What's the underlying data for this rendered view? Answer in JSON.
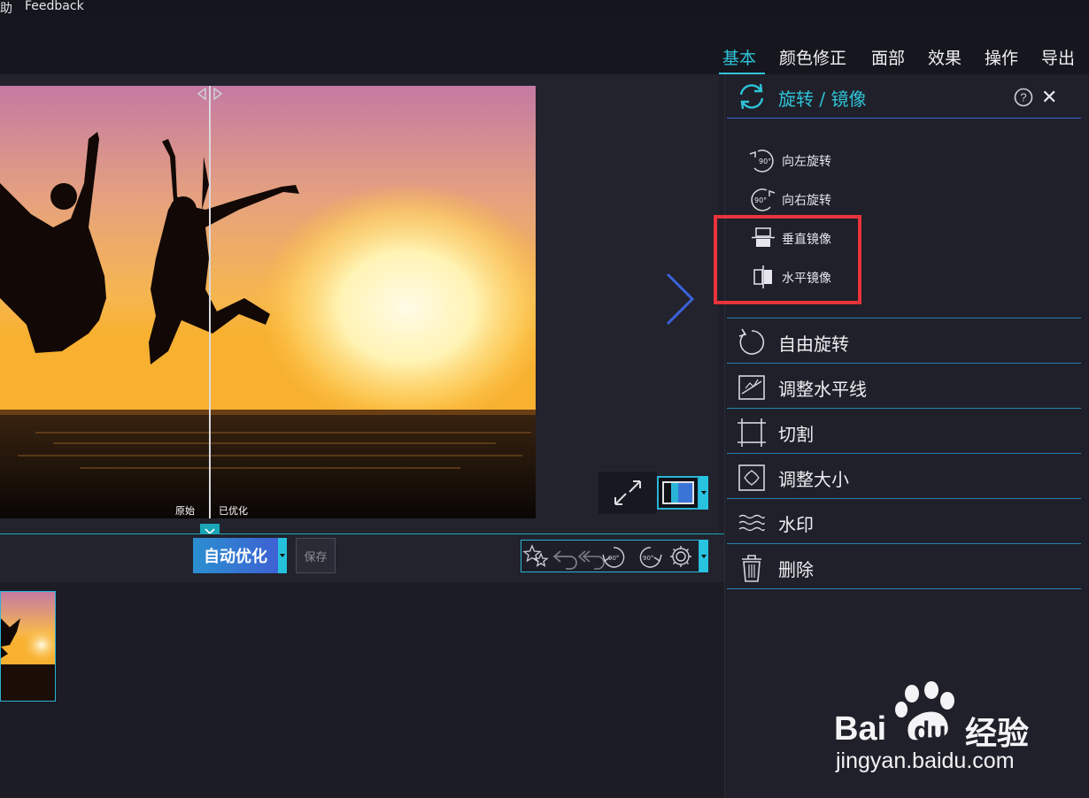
{
  "menu": {
    "items": [
      "助",
      "Feedback"
    ]
  },
  "tabs": [
    {
      "label": "基本",
      "active": true
    },
    {
      "label": "颜色修正"
    },
    {
      "label": "面部"
    },
    {
      "label": "效果"
    },
    {
      "label": "操作"
    },
    {
      "label": "导出"
    }
  ],
  "compare": {
    "original_label": "原始",
    "optimized_label": "已优化"
  },
  "toolbar": {
    "auto_optimize_label": "自动优化",
    "save_label": "保存"
  },
  "section": {
    "title": "旋转 / 镜像",
    "help_icon": "question-circle-icon",
    "close_label": "✕",
    "sub_items": [
      {
        "label": "向左旋转",
        "icon": "rotate-left-90-icon",
        "icon_text": "90°"
      },
      {
        "label": "向右旋转",
        "icon": "rotate-right-90-icon",
        "icon_text": "90°"
      },
      {
        "label": "垂直镜像",
        "icon": "flip-vertical-icon"
      },
      {
        "label": "水平镜像",
        "icon": "flip-horizontal-icon"
      }
    ]
  },
  "panel_items": [
    {
      "label": "自由旋转",
      "icon": "free-rotate-icon"
    },
    {
      "label": "调整水平线",
      "icon": "straighten-icon"
    },
    {
      "label": "切割",
      "icon": "crop-icon"
    },
    {
      "label": "调整大小",
      "icon": "resize-icon"
    },
    {
      "label": "水印",
      "icon": "watermark-icon"
    },
    {
      "label": "删除",
      "icon": "trash-icon"
    }
  ],
  "toolbar_icons": [
    "favorite-stars-icon",
    "undo-icon",
    "undo-all-icon",
    "rotate-left-90-icon",
    "rotate-right-90-icon",
    "settings-gear-icon"
  ],
  "toolbar_icon_text": "90°",
  "watermark": {
    "brand_left": "Bai",
    "brand_du": "du",
    "brand_cn": "经验",
    "url": "jingyan.baidu.com"
  },
  "colors": {
    "accent": "#2fc3d8",
    "highlight": "#e8343a",
    "panel_bg": "#1f2029"
  }
}
